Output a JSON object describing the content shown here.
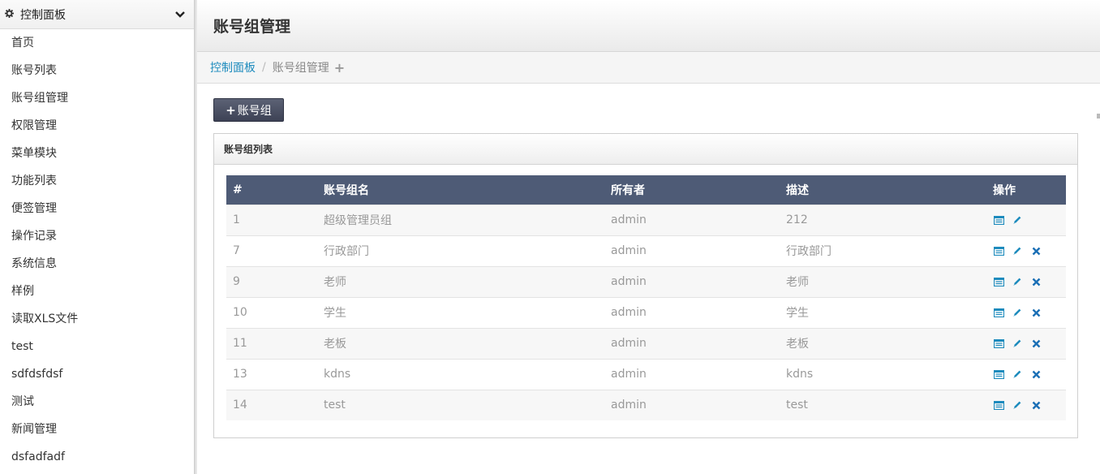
{
  "sidebar": {
    "title": "控制面板",
    "items": [
      {
        "label": "首页"
      },
      {
        "label": "账号列表"
      },
      {
        "label": "账号组管理"
      },
      {
        "label": "权限管理"
      },
      {
        "label": "菜单模块"
      },
      {
        "label": "功能列表"
      },
      {
        "label": "便签管理"
      },
      {
        "label": "操作记录"
      },
      {
        "label": "系统信息"
      },
      {
        "label": "样例"
      },
      {
        "label": "读取XLS文件"
      },
      {
        "label": "test"
      },
      {
        "label": "sdfdsfdsf"
      },
      {
        "label": "测试"
      },
      {
        "label": "新闻管理"
      },
      {
        "label": "dsfadfadf"
      }
    ]
  },
  "header": {
    "title": "账号组管理"
  },
  "breadcrumb": {
    "home": "控制面板",
    "separator": "/",
    "current": "账号组管理"
  },
  "toolbar": {
    "add_label": "账号组"
  },
  "panel": {
    "title": "账号组列表"
  },
  "table": {
    "columns": [
      "#",
      "账号组名",
      "所有者",
      "描述",
      "操作"
    ],
    "rows": [
      {
        "id": "1",
        "name": "超级管理员组",
        "owner": "admin",
        "desc": "212"
      },
      {
        "id": "7",
        "name": "行政部门",
        "owner": "admin",
        "desc": "行政部门"
      },
      {
        "id": "9",
        "name": "老师",
        "owner": "admin",
        "desc": "老师"
      },
      {
        "id": "10",
        "name": "学生",
        "owner": "admin",
        "desc": "学生"
      },
      {
        "id": "11",
        "name": "老板",
        "owner": "admin",
        "desc": "老板"
      },
      {
        "id": "13",
        "name": "kdns",
        "owner": "admin",
        "desc": "kdns"
      },
      {
        "id": "14",
        "name": "test",
        "owner": "admin",
        "desc": "test"
      }
    ]
  },
  "colors": {
    "accent": "#1d8bbd",
    "table_header": "#4e5b76",
    "delete": "#1a6fb5"
  }
}
